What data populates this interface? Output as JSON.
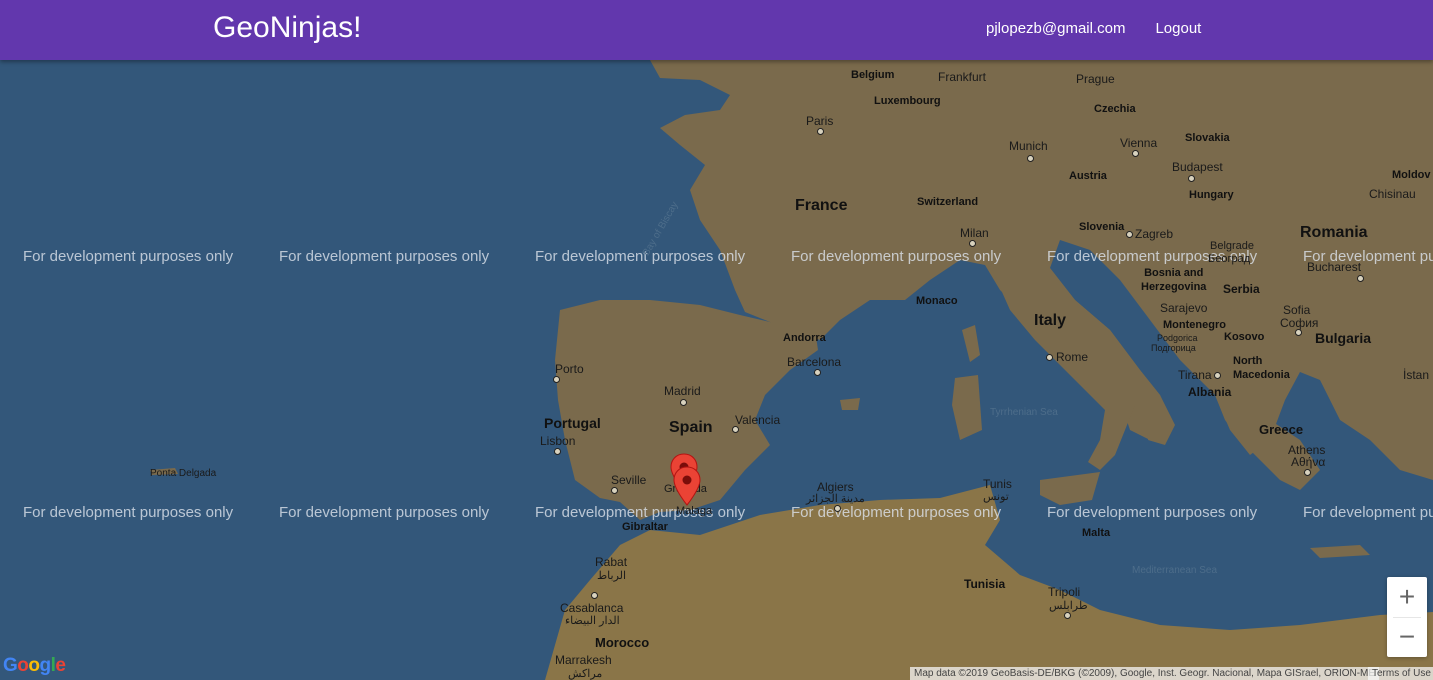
{
  "navbar": {
    "brand": "GeoNinjas!",
    "user_email": "pjlopezb@gmail.com",
    "logout_label": "Logout"
  },
  "map": {
    "dev_watermark": "For development purposes only",
    "countries": {
      "france": "France",
      "spain": "Spain",
      "portugal": "Portugal",
      "italy": "Italy",
      "romania": "Romania",
      "bulgaria": "Bulgaria",
      "greece": "Greece",
      "morocco": "Morocco",
      "tunisia": "Tunisia",
      "albania": "Albania",
      "serbia": "Serbia",
      "kosovo": "Kosovo",
      "montenegro": "Montenegro",
      "north_macedonia": "North\nMacedonia",
      "bosnia": "Bosnia and\nHerzegovina",
      "slovenia": "Slovenia",
      "switzerland": "Switzerland",
      "austria": "Austria",
      "hungary": "Hungary",
      "slovakia": "Slovakia",
      "czechia": "Czechia",
      "belgium": "Belgium",
      "luxembourg": "Luxembourg",
      "moldova": "Moldov",
      "andorra": "Andorra",
      "monaco": "Monaco",
      "malta": "Malta",
      "gibraltar": "Gibraltar"
    },
    "cities": {
      "paris": "Paris",
      "frankfurt": "Frankfurt",
      "prague": "Prague",
      "munich": "Munich",
      "vienna": "Vienna",
      "budapest": "Budapest",
      "chisinau": "Chisinau",
      "milan": "Milan",
      "zagreb": "Zagreb",
      "belgrade": "Belgrade",
      "beograd": "Београд",
      "bucharest": "Bucharest",
      "sarajevo": "Sarajevo",
      "sofia": "Sofia",
      "sofia_local": "София",
      "podgorica": "Podgorica",
      "podgorica_local": "Подгорица",
      "rome": "Rome",
      "tirana": "Tirana",
      "istanbul": "İstan",
      "athens": "Athens",
      "athens_local": "Αθήνα",
      "porto": "Porto",
      "madrid": "Madrid",
      "barcelona": "Barcelona",
      "valencia": "Valencia",
      "lisbon": "Lisbon",
      "seville": "Seville",
      "granada": "Granada",
      "malaga": "Malaga",
      "algiers": "Algiers",
      "algiers_local": "مدينة الجزائر",
      "tunis": "Tunis",
      "tunis_local": "تونس",
      "rabat": "Rabat",
      "rabat_local": "الرباط",
      "casablanca": "Casablanca",
      "casablanca_local": "الدار البيضاء",
      "marrakesh": "Marrakesh",
      "marrakesh_local": "مراكش",
      "tripoli": "Tripoli",
      "tripoli_local": "طرابلس",
      "ponta_delgada": "Ponta Delgada"
    },
    "water": {
      "bay_of_biscay": "Bay of Biscay",
      "tyrrhenian_sea": "Tyrrhenian Sea",
      "mediterranean_sea": "Mediterranean Sea"
    },
    "zoom_in": "+",
    "zoom_out": "−",
    "attribution": "Map data ©2019 GeoBasis-DE/BKG (©2009), Google, Inst. Geogr. Nacional, Mapa GISrael, ORION-ME",
    "terms": "Terms of Use",
    "google_logo": "Google",
    "colors": {
      "sea": "#33577a",
      "land": "#7a6a4c",
      "navbar": "#6237ad",
      "marker": "#ea4335"
    }
  }
}
